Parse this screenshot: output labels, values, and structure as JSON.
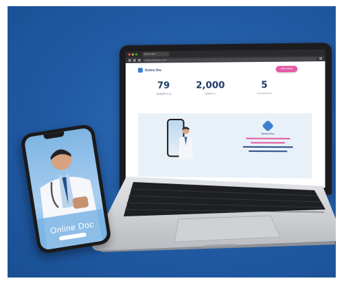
{
  "laptop": {
    "browser": {
      "tab_title": "Online Doc",
      "url": "www.onlinedoc.co.th"
    },
    "page": {
      "logo_text": "Online Doc",
      "cta_label": "ปรึกษาแพทย์",
      "stats": [
        {
          "value": "79",
          "label": "แพทย์ผู้เชี่ยวชาญ"
        },
        {
          "value": "2,000",
          "label": "ผู้ใช้บริการ"
        },
        {
          "value": "5",
          "label": "สาขาเฉพาะทาง"
        }
      ],
      "banner_logo_text": "Online Doc"
    }
  },
  "phone": {
    "title": "Online Doc"
  },
  "colors": {
    "background": "#215aa3",
    "accent_pink": "#e35ba7",
    "stat_text": "#1e3a67",
    "banner_bg": "#e9f1f8"
  }
}
